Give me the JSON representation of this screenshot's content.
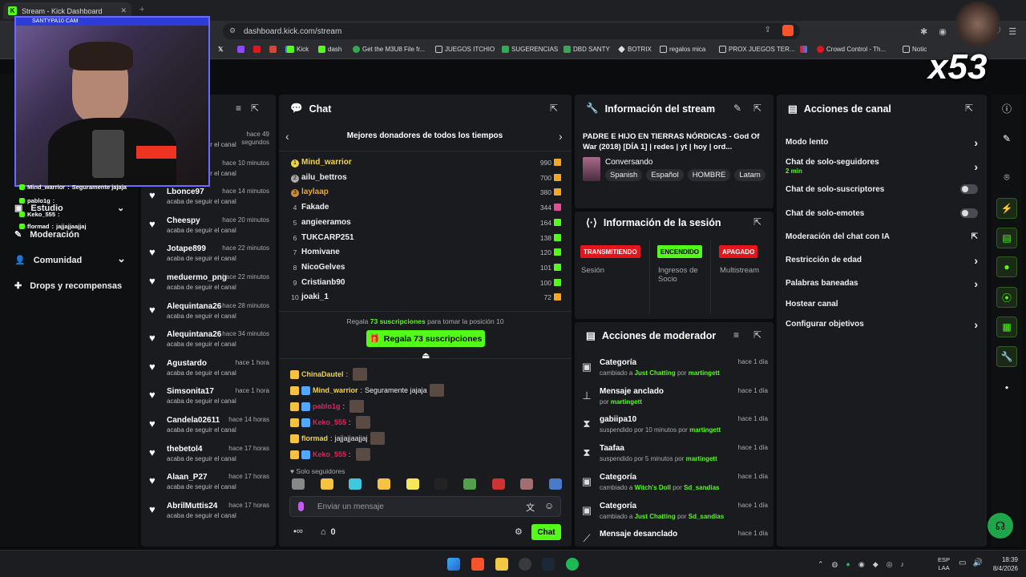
{
  "browser": {
    "tab_title": "Stream - Kick Dashboard",
    "tab_favicon": "K",
    "url": "dashboard.kick.com/stream",
    "bookmarks": [
      "Kick",
      "dash",
      "Get the M3U8 File fr...",
      "JUEGOS ITCHIO",
      "SUGERENCIAS",
      "DBD SANTY",
      "BOTRIX",
      "regalos mica",
      "PROX JUEGOS TER...",
      "Crowd Control - Th...",
      "Notic"
    ]
  },
  "webcam": {
    "label": "SANTYPA10 CAM",
    "overlay_chat": [
      {
        "name": "Mind_warrior",
        "text": "Seguramente jajaja"
      },
      {
        "name": "pablo1g",
        "text": ""
      },
      {
        "name": "Keko_555",
        "text": ""
      },
      {
        "name": "flormad",
        "text": "jajjajjaajjaj"
      }
    ]
  },
  "multiplier": "x53",
  "sidebar": {
    "partial_header": "es",
    "items": [
      {
        "label": "Estudio"
      },
      {
        "label": "Moderación"
      },
      {
        "label": "Comunidad"
      },
      {
        "label": "Drops y recompensas"
      }
    ]
  },
  "activity_feed": [
    {
      "name": "",
      "time": "hace 49 segundos",
      "action": "acaba de seguir el canal"
    },
    {
      "name": "",
      "time": "hace 10 minutos",
      "action": "acaba de seguir el canal"
    },
    {
      "name": "Lbonce97",
      "time": "hace 14 minutos",
      "action": "acaba de seguir el canal"
    },
    {
      "name": "Cheespy",
      "time": "hace 20 minutos",
      "action": "acaba de seguir el canal"
    },
    {
      "name": "Jotape899",
      "time": "hace 22 minutos",
      "action": "acaba de seguir el canal"
    },
    {
      "name": "meduermo_png",
      "time": "hace 22 minutos",
      "action": "acaba de seguir el canal"
    },
    {
      "name": "Alequintana26",
      "time": "hace 28 minutos",
      "action": "acaba de seguir el canal"
    },
    {
      "name": "Alequintana26",
      "time": "hace 34 minutos",
      "action": "acaba de seguir el canal"
    },
    {
      "name": "Agustardo",
      "time": "hace 1 hora",
      "action": "acaba de seguir el canal"
    },
    {
      "name": "Simsonita17",
      "time": "hace 1 hora",
      "action": "acaba de seguir el canal"
    },
    {
      "name": "Candela02611",
      "time": "hace 14 horas",
      "action": "acaba de seguir el canal"
    },
    {
      "name": "thebetol4",
      "time": "hace 17 horas",
      "action": "acaba de seguir el canal"
    },
    {
      "name": "Alaan_P27",
      "time": "hace 17 horas",
      "action": "acaba de seguir el canal"
    },
    {
      "name": "AbrilMuttis24",
      "time": "hace 17 horas",
      "action": "acaba de seguir el canal"
    }
  ],
  "chat": {
    "title": "Chat",
    "donors_title": "Mejores donadores de todos los tiempos",
    "donors": [
      {
        "rank": "1",
        "name": "Mind_warrior",
        "amount": "990"
      },
      {
        "rank": "2",
        "name": "ailu_bettros",
        "amount": "700"
      },
      {
        "rank": "3",
        "name": "laylaap",
        "amount": "380"
      },
      {
        "rank": "4",
        "name": "Fakade",
        "amount": "344"
      },
      {
        "rank": "5",
        "name": "angieeramos",
        "amount": "164"
      },
      {
        "rank": "6",
        "name": "TUKCARP251",
        "amount": "138"
      },
      {
        "rank": "7",
        "name": "Homivane",
        "amount": "120"
      },
      {
        "rank": "8",
        "name": "NicoGelves",
        "amount": "101"
      },
      {
        "rank": "9",
        "name": "Cristianb90",
        "amount": "100"
      },
      {
        "rank": "10",
        "name": "joaki_1",
        "amount": "72"
      }
    ],
    "gift_prefix": "Regala",
    "gift_count": "73 suscripciones",
    "gift_suffix": "para tomar la posición 10",
    "gift_button": "Regala 73 suscripciones",
    "messages": [
      {
        "name": "ChinaDautel",
        "text": "",
        "color": "#f5d442"
      },
      {
        "name": "Mind_warrior",
        "text": "Seguramente jajaja",
        "color": "#f5d442"
      },
      {
        "name": "pablo1g",
        "text": "",
        "color": "#e0245e"
      },
      {
        "name": "Keko_555",
        "text": "",
        "color": "#e0245e"
      },
      {
        "name": "flormad",
        "text": "jajjajjaajjaj",
        "color": "#f5d442"
      },
      {
        "name": "Keko_555",
        "text": "",
        "color": "#e0245e"
      }
    ],
    "followers_only": "Solo seguidores",
    "input_placeholder": "Enviar un mensaje",
    "counter": "0",
    "send_button": "Chat"
  },
  "stream_info": {
    "title_header": "Información del stream",
    "stream_title": "PADRE E HIJO EN TIERRAS NÓRDICAS - God Of War (2018) [DÍA 1] | redes | yt | hoy | ord...",
    "category": "Conversando",
    "tags": [
      "Spanish",
      "Español",
      "HOMBRE",
      "Latam"
    ]
  },
  "session": {
    "title": "Información de la sesión",
    "statuses": [
      {
        "tag": "TRANSMITIENDO",
        "label": "Sesión",
        "color": "#e3161e"
      },
      {
        "tag": "ENCENDIDO",
        "label": "Ingresos de Socio",
        "color": "#53fc18"
      },
      {
        "tag": "APAGADO",
        "label": "Multistream",
        "color": "#e3161e"
      }
    ]
  },
  "mod_actions": {
    "title": "Acciones de moderador",
    "items": [
      {
        "icon": "category-icon",
        "title": "Categoría",
        "sub_pre": "cambiado a",
        "target": "Just Chatting",
        "sub_mid": "por",
        "by": "martingett",
        "time": "hace 1 día"
      },
      {
        "icon": "pin-icon",
        "title": "Mensaje anclado",
        "sub_pre": "por",
        "target": "martingett",
        "sub_mid": "",
        "by": "",
        "time": "hace 1 día"
      },
      {
        "icon": "timeout-icon",
        "title": "gabiipa10",
        "sub_pre": "suspendido por 10 minutos por",
        "target": "martingett",
        "sub_mid": "",
        "by": "",
        "time": "hace 1 día"
      },
      {
        "icon": "timeout-icon",
        "title": "Taafaa",
        "sub_pre": "suspendido por 5 minutos por",
        "target": "martingett",
        "sub_mid": "",
        "by": "",
        "time": "hace 1 día"
      },
      {
        "icon": "category-icon",
        "title": "Categoría",
        "sub_pre": "cambiado a",
        "target": "Witch's Doll",
        "sub_mid": "por",
        "by": "Sd_sandias",
        "time": "hace 1 día"
      },
      {
        "icon": "category-icon",
        "title": "Categoría",
        "sub_pre": "cambiado a",
        "target": "Just Chatting",
        "sub_mid": "por",
        "by": "Sd_sandias",
        "time": "hace 1 día"
      },
      {
        "icon": "unpin-icon",
        "title": "Mensaje desanclado",
        "sub_pre": "",
        "target": "",
        "sub_mid": "",
        "by": "",
        "time": "hace 1 día"
      }
    ]
  },
  "channel_actions": {
    "title": "Acciones de canal",
    "items": [
      {
        "label": "Modo lento",
        "control": "chevron",
        "sub": ""
      },
      {
        "label": "Chat de solo-seguidores",
        "control": "chevron",
        "sub": "2 min"
      },
      {
        "label": "Chat de solo-suscriptores",
        "control": "toggle",
        "sub": ""
      },
      {
        "label": "Chat de solo-emotes",
        "control": "toggle",
        "sub": ""
      },
      {
        "label": "Moderación del chat con IA",
        "control": "external",
        "sub": ""
      },
      {
        "label": "Restricción de edad",
        "control": "chevron",
        "sub": ""
      },
      {
        "label": "Palabras baneadas",
        "control": "chevron",
        "sub": ""
      },
      {
        "label": "Hostear canal",
        "control": "none",
        "sub": ""
      },
      {
        "label": "Configurar objetivos",
        "control": "chevron",
        "sub": ""
      }
    ]
  },
  "taskbar": {
    "lang": "ESP",
    "region": "LAA",
    "time": "18:39",
    "date": "8/4/2026"
  },
  "colors": {
    "accent": "#53fc18",
    "danger": "#e3161e",
    "panel": "#191b1f"
  }
}
